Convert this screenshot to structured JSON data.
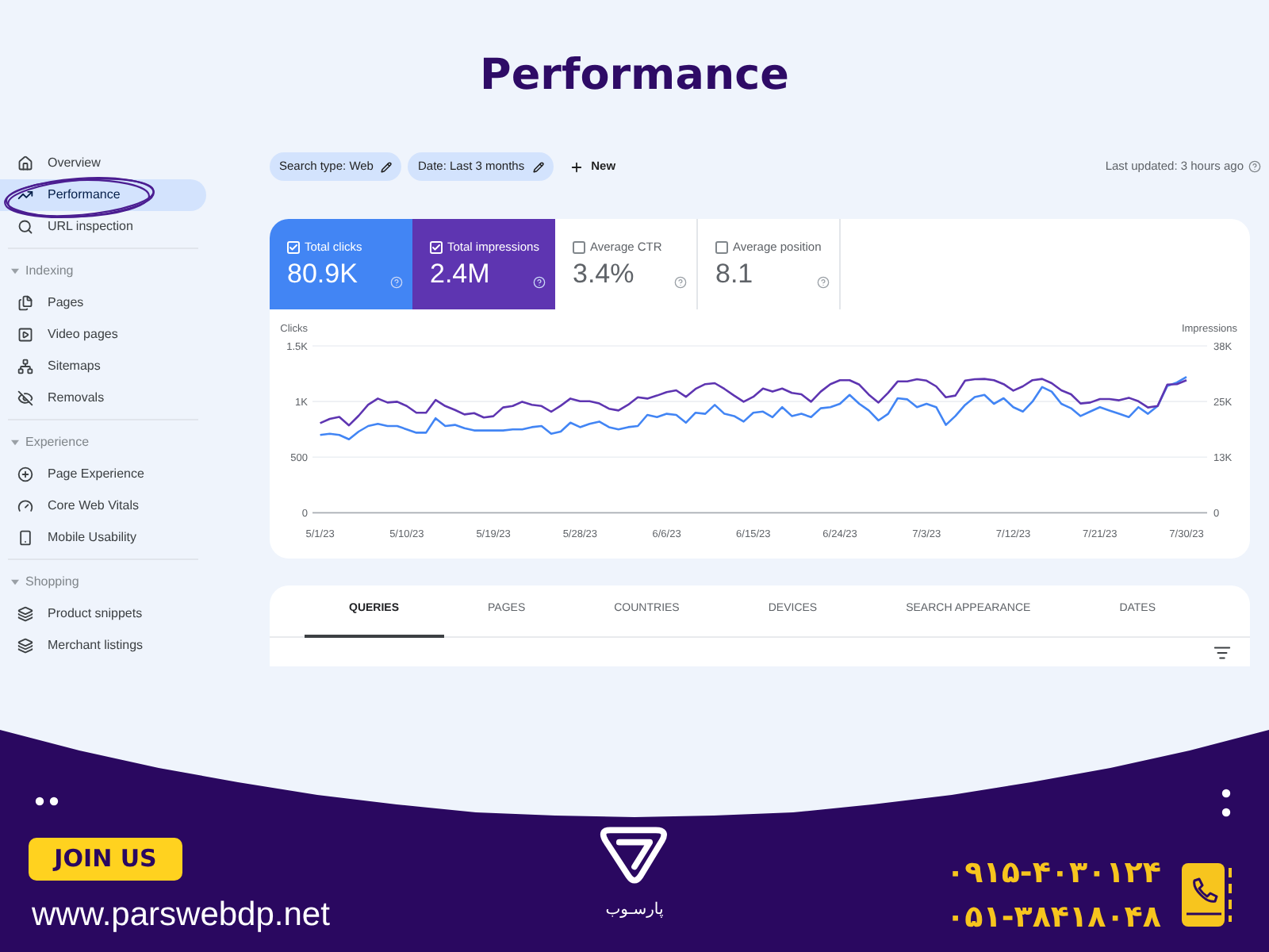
{
  "title": "Performance",
  "sidebar": {
    "items": [
      {
        "label": "Overview",
        "selected": false,
        "circled": false
      },
      {
        "label": "Performance",
        "selected": true,
        "circled": true
      },
      {
        "label": "URL inspection",
        "selected": false,
        "circled": false
      }
    ],
    "sections": [
      {
        "title": "Indexing",
        "expanded": true,
        "items": [
          {
            "label": "Pages",
            "selected": false,
            "circled": false
          },
          {
            "label": "Video pages",
            "selected": false,
            "circled": false
          },
          {
            "label": "Sitemaps",
            "selected": false,
            "circled": false
          },
          {
            "label": "Removals",
            "selected": false,
            "circled": false
          }
        ]
      },
      {
        "title": "Experience",
        "expanded": true,
        "items": [
          {
            "label": "Page Experience",
            "selected": false,
            "circled": false
          },
          {
            "label": "Core Web Vitals",
            "selected": false,
            "circled": false
          },
          {
            "label": "Mobile Usability",
            "selected": false,
            "circled": false
          }
        ]
      },
      {
        "title": "Shopping",
        "expanded": true,
        "items": [
          {
            "label": "Product snippets",
            "selected": false,
            "circled": false
          },
          {
            "label": "Merchant listings",
            "selected": false,
            "circled": false
          }
        ]
      }
    ]
  },
  "toolbar": {
    "filters": [
      {
        "label": "Search type: Web"
      },
      {
        "label": "Date: Last 3 months"
      }
    ],
    "new_button": "New",
    "last_updated": "Last updated: 3 hours ago"
  },
  "metrics": [
    {
      "label": "Total clicks",
      "value": "80.9K",
      "checked": true,
      "color": "#4285f4"
    },
    {
      "label": "Total impressions",
      "value": "2.4M",
      "checked": true,
      "color": "#5e35b1"
    },
    {
      "label": "Average CTR",
      "value": "3.4%",
      "checked": false
    },
    {
      "label": "Average position",
      "value": "8.1",
      "checked": false
    }
  ],
  "chart": {
    "chart_data": {
      "type": "line",
      "ylabel": "Clicks",
      "y2label": "Impressions",
      "ylim": [
        0,
        1500
      ],
      "y2lim": [
        0,
        38000
      ],
      "yticks": [
        0,
        500,
        {
          "value": 1000,
          "label": "1K"
        },
        {
          "value": 1500,
          "label": "1.5K"
        }
      ],
      "y2ticks": [
        0,
        {
          "value": 12667,
          "label": "13K"
        },
        {
          "value": 25333,
          "label": "25K"
        },
        {
          "value": 38000,
          "label": "38K"
        }
      ],
      "categories": [
        "5/1/23",
        null,
        null,
        null,
        null,
        null,
        null,
        null,
        null,
        "5/10/23",
        null,
        null,
        null,
        null,
        null,
        null,
        null,
        null,
        "5/19/23",
        null,
        null,
        null,
        null,
        null,
        null,
        null,
        null,
        "5/28/23",
        null,
        null,
        null,
        null,
        null,
        null,
        null,
        null,
        "6/6/23",
        null,
        null,
        null,
        null,
        null,
        null,
        null,
        null,
        "6/15/23",
        null,
        null,
        null,
        null,
        null,
        null,
        null,
        null,
        "6/24/23",
        null,
        null,
        null,
        null,
        null,
        null,
        null,
        null,
        "7/3/23",
        null,
        null,
        null,
        null,
        null,
        null,
        null,
        null,
        "7/12/23",
        null,
        null,
        null,
        null,
        null,
        null,
        null,
        null,
        "7/21/23",
        null,
        null,
        null,
        null,
        null,
        null,
        null,
        null,
        "7/30/23"
      ],
      "series": [
        {
          "color": "#4285f4",
          "values": [
            700,
            710,
            700,
            660,
            730,
            780,
            800,
            780,
            780,
            750,
            720,
            720,
            850,
            780,
            790,
            760,
            740,
            740,
            740,
            740,
            750,
            750,
            770,
            780,
            710,
            730,
            810,
            770,
            800,
            820,
            770,
            750,
            770,
            780,
            880,
            860,
            890,
            880,
            810,
            900,
            890,
            970,
            890,
            870,
            820,
            900,
            910,
            860,
            950,
            870,
            890,
            860,
            940,
            950,
            980,
            1060,
            980,
            920,
            830,
            890,
            1030,
            1020,
            950,
            980,
            950,
            790,
            870,
            970,
            1040,
            1060,
            980,
            1030,
            950,
            910,
            1000,
            1130,
            1090,
            980,
            940,
            870,
            910,
            950,
            920,
            890,
            860,
            950,
            890,
            960,
            1140,
            1170,
            1220
          ]
        },
        {
          "axis": "y2",
          "color": "#5e35b1",
          "values": [
            20400,
            21400,
            21800,
            19900,
            22100,
            24600,
            26000,
            25100,
            25300,
            24300,
            22800,
            22800,
            25700,
            24300,
            23400,
            22400,
            22700,
            21700,
            22000,
            24000,
            24300,
            25300,
            24600,
            24300,
            23000,
            24400,
            26000,
            25400,
            25400,
            24900,
            23700,
            23300,
            24600,
            26300,
            26000,
            26700,
            27500,
            27900,
            26400,
            28200,
            29300,
            29500,
            28200,
            26700,
            25300,
            26400,
            28300,
            27600,
            28300,
            27300,
            27000,
            25300,
            27600,
            29300,
            30200,
            30200,
            29200,
            26900,
            25100,
            27300,
            29900,
            29900,
            30400,
            30100,
            28800,
            26300,
            26700,
            30100,
            30400,
            30500,
            30200,
            29300,
            27800,
            28800,
            30200,
            30500,
            29500,
            27900,
            27000,
            24900,
            25100,
            25900,
            25900,
            25600,
            26200,
            25400,
            24000,
            24300,
            29200,
            29300,
            30200
          ]
        }
      ]
    }
  },
  "tabs": [
    {
      "label": "QUERIES",
      "selected": true
    },
    {
      "label": "PAGES",
      "selected": false
    },
    {
      "label": "COUNTRIES",
      "selected": false
    },
    {
      "label": "DEVICES",
      "selected": false
    },
    {
      "label": "SEARCH APPEARANCE",
      "selected": false
    },
    {
      "label": "DATES",
      "selected": false
    }
  ],
  "footer": {
    "join_button": "JOIN US",
    "website": "www.parswebdp.net",
    "brand_name": "پارسـوب",
    "phones": [
      "۰۹۱۵-۴۰۳۰۱۲۴",
      "۰۵۱-۳۸۴۱۸۰۴۸"
    ]
  }
}
